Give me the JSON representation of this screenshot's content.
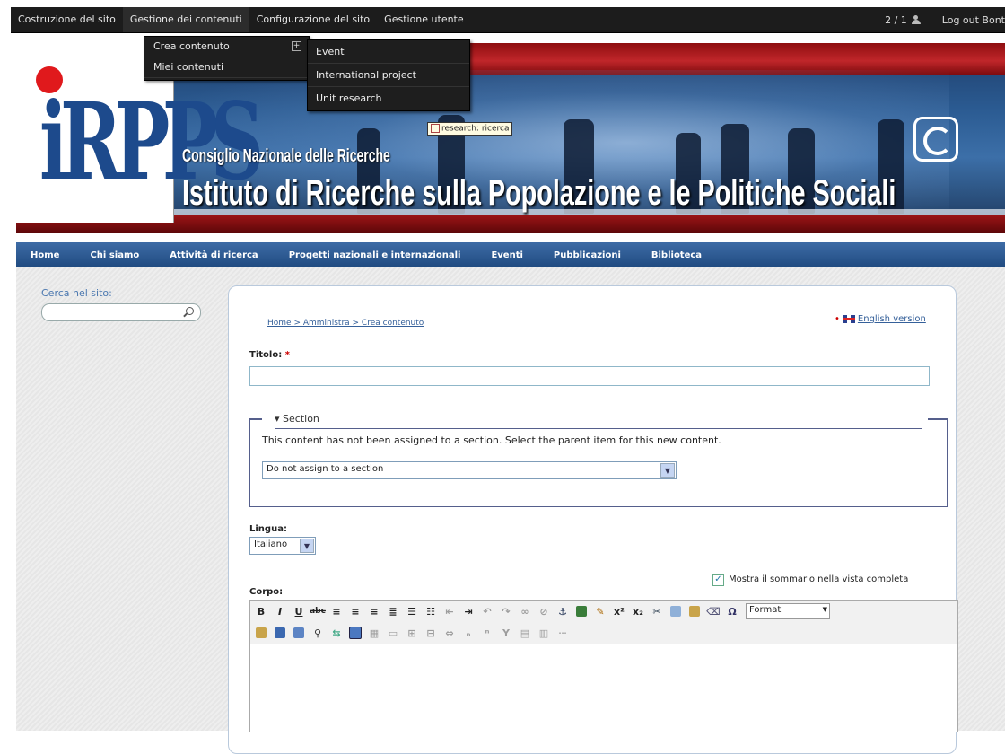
{
  "admin_bar": {
    "menu": [
      "Costruzione del sito",
      "Gestione dei contenuti",
      "Configurazione del sito",
      "Gestione utente"
    ],
    "users_count": "2 / 1",
    "logout": "Log out Bont"
  },
  "dropdown_content": {
    "items": [
      "Crea contenuto",
      "Miei contenuti"
    ]
  },
  "dropdown_types": {
    "items": [
      "Event",
      "International project",
      "Unit research"
    ]
  },
  "tooltip": "research: ricerca",
  "header": {
    "org": "Consiglio Nazionale delle Ricerche",
    "institute": "Istituto di Ricerche sulla Popolazione e le Politiche Sociali"
  },
  "main_nav": [
    "Home",
    "Chi siamo",
    "Attività di ricerca",
    "Progetti nazionali e internazionali",
    "Eventi",
    "Pubblicazioni",
    "Biblioteca"
  ],
  "sidebar": {
    "search_label": "Cerca nel sito:",
    "search_value": ""
  },
  "breadcrumb": "Home > Amministra > Crea contenuto",
  "english_link": "English version",
  "form": {
    "title_label": "Titolo:",
    "required_mark": "*",
    "title_value": "",
    "section_legend": "Section",
    "section_desc": "This content has not been assigned to a section. Select the parent item for this new content.",
    "section_select": "Do not assign to a section",
    "language_label": "Lingua:",
    "language_select": "Italiano",
    "summary_checkbox": "Mostra il sommario nella vista completa",
    "body_label": "Corpo:",
    "format_select": "Format"
  },
  "toolbar_icons_row1": [
    "bold-icon",
    "italic-icon",
    "underline-icon",
    "strike-icon",
    "align-left-icon",
    "align-center-icon",
    "align-right-icon",
    "justify-icon",
    "bulleted-list-icon",
    "numbered-list-icon",
    "outdent-icon",
    "indent-icon",
    "undo-icon",
    "redo-icon",
    "link-icon",
    "unlink-icon",
    "anchor-icon",
    "image-icon",
    "cleanup-icon",
    "superscript-icon",
    "subscript-icon",
    "cut-icon",
    "copy-icon",
    "paste-icon",
    "eraser-icon",
    "omega-icon"
  ],
  "toolbar_icons_row2": [
    "paste-text-icon",
    "paste-word-icon",
    "select-all-icon",
    "find-icon",
    "replace-icon",
    "source-icon",
    "table-icon",
    "hr-icon",
    "row-insert-icon",
    "col-insert-icon",
    "merge-icon",
    "sub-icon",
    "sup-icon",
    "special-icon",
    "media-icon",
    "flash-icon",
    "more-icon"
  ],
  "colors": {
    "admin_bar_bg": "#1c1c1c",
    "nav_bg": "#2b5a92",
    "link": "#35609a",
    "required": "#cc0000"
  }
}
